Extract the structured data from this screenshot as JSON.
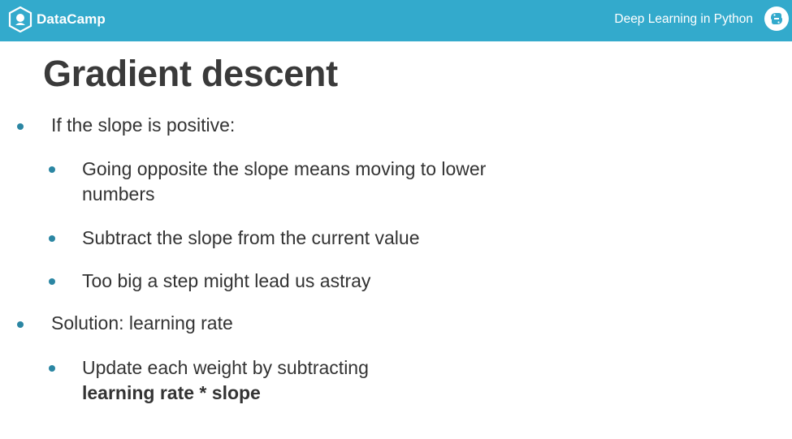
{
  "header": {
    "brand": "DataCamp",
    "course_title": "Deep Learning in Python",
    "background_color": "#33aacc",
    "logo_icon": "datacamp-logo-icon",
    "badge_icon": "python-icon"
  },
  "slide": {
    "title": "Gradient descent",
    "bullet_color": "#2b86a3",
    "bullets": [
      {
        "text": "If the slope is positive:",
        "sub": [
          "Going opposite the slope means moving to lower numbers",
          "Subtract the slope from the current value",
          "Too big a step might lead us astray"
        ]
      },
      {
        "text": "Solution: learning rate",
        "sub": [
          {
            "text": "Update each weight by subtracting",
            "strong": "learning rate * slope"
          }
        ]
      }
    ]
  }
}
